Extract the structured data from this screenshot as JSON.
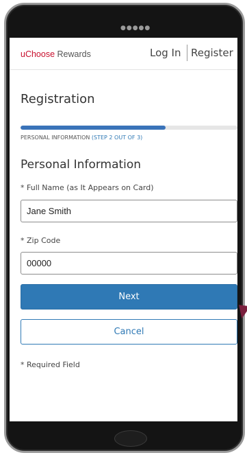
{
  "device": {
    "speaker_dots": "●●●●●"
  },
  "header": {
    "brand_prefix": "uChoose",
    "brand_suffix": " Rewards",
    "login_label": "Log In",
    "register_label": "Register",
    "brand_color": "#c8102e"
  },
  "registration": {
    "title": "Registration",
    "progress": 0.67,
    "step_name": "PERSONAL INFORMATION ",
    "step_indicator": "(STEP 2 OUT OF 3)",
    "section_title": "Personal Information"
  },
  "form": {
    "full_name_label": "* Full Name (as It Appears on Card)",
    "full_name_value": "Jane Smith",
    "zip_label": "* Zip Code",
    "zip_value": "00000",
    "next_label": "Next",
    "cancel_label": "Cancel",
    "required_note": "* Required Field"
  },
  "colors": {
    "primary": "#2f79b5",
    "progress": "#3a73b9"
  }
}
